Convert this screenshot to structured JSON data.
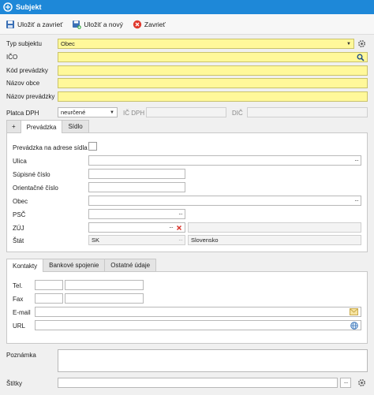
{
  "window": {
    "title": "Subjekt",
    "accent": "#1e88d8"
  },
  "toolbar": {
    "save_close": "Uložiť a zavrieť",
    "save_new": "Uložiť a nový",
    "close": "Zavrieť"
  },
  "form": {
    "subject_type_label": "Typ subjektu",
    "subject_type_value": "Obec",
    "ico_label": "IČO",
    "establishment_code_label": "Kód prevádzky",
    "municipality_name_label": "Názov obce",
    "establishment_name_label": "Názov prevádzky",
    "vat_payer_label": "Platca DPH",
    "vat_payer_value": "neurčené",
    "ic_dph_label": "IČ DPH",
    "dic_label": "DIČ",
    "required_color": "#fff89a"
  },
  "address_tabs": {
    "add": "+",
    "establishment": "Prevádzka",
    "seat": "Sídlo"
  },
  "address": {
    "at_seat_label": "Prevádzka na adrese sídla",
    "street_label": "Ulica",
    "registry_no_label": "Súpisné číslo",
    "orientation_no_label": "Orientačné číslo",
    "municipality_label": "Obec",
    "postal_code_label": "PSČ",
    "zuj_label": "ZÚJ",
    "state_label": "Štát",
    "state_code": "SK",
    "state_name": "Slovensko"
  },
  "contact_tabs": {
    "contacts": "Kontakty",
    "bank": "Bankové spojenie",
    "other": "Ostatné údaje"
  },
  "contacts": {
    "tel_label": "Tel.",
    "fax_label": "Fax",
    "email_label": "E-mail",
    "url_label": "URL"
  },
  "footer": {
    "note_label": "Poznámka",
    "tags_label": "Štítky"
  },
  "icons": {
    "app": "app-logo-icon",
    "save_close": "save-icon",
    "save_new": "save-new-icon",
    "close": "close-circle-icon",
    "settings": "gear-icon",
    "search": "search-icon",
    "mail": "envelope-icon",
    "web": "globe-icon",
    "clear": "clear-x-icon"
  }
}
